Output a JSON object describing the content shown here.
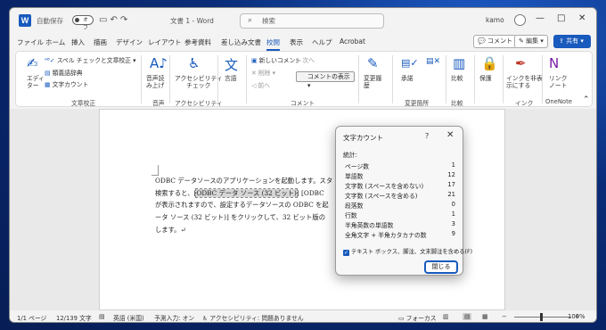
{
  "titlebar": {
    "autosave_label": "自動保存",
    "autosave_state": "オフ",
    "doc_title": "文書 1 - Word",
    "search_placeholder": "検索",
    "user_name": "kamo",
    "qat_icons": [
      "save-icon",
      "undo-icon",
      "redo-icon"
    ]
  },
  "menu": {
    "items": [
      "ファイル",
      "ホーム",
      "挿入",
      "描画",
      "デザイン",
      "レイアウト",
      "参考資料",
      "差し込み文書",
      "校閲",
      "表示",
      "ヘルプ",
      "Acrobat"
    ],
    "active": "校閲",
    "comment_btn": "コメント",
    "edit_btn": "編集",
    "share_btn": "共有"
  },
  "ribbon": {
    "editor": "エディ\nター",
    "spell": "スペル チェックと文章校正",
    "thesaurus": "類義語辞典",
    "word_count": "文字カウント",
    "read_aloud": "音声読\nみ上げ",
    "accessibility": "アクセシビリティ\nチェック",
    "language": "言語",
    "new_comment": "新しいコメント",
    "delete": "削除",
    "prev": "前へ",
    "next": "次へ",
    "show_comments": "コメントの表示",
    "track": "変更履\n歴",
    "accept": "承諾",
    "compare": "比較",
    "protect": "保護",
    "ink": "インクを非表\n示にする",
    "onenote": "リンク\nノート",
    "groups": {
      "proofing": "文章校正",
      "speech": "音声",
      "accessibility": "アクセシビリティ",
      "language": "言語",
      "comments": "コメント",
      "changes": "変更箇所",
      "compare": "比較",
      "ink": "インク",
      "onenote": "OneNote"
    }
  },
  "document": {
    "line1": "ODBC データソースのアプリケーションを起動します。スタ",
    "line2_pre": "検索すると、[",
    "line2_hl": "ODBC データ ソース (32 ビット)",
    "line2_post": "] [ODBC",
    "line3": "が表示されますので、設定するデータソースの ODBC を起",
    "line4": "ータ ソース (32 ビット)] をクリックして、32 ビット版の",
    "line5": "します。↵"
  },
  "dialog": {
    "title": "文字カウント",
    "help": "?",
    "stats_label": "統計:",
    "stats": [
      {
        "label": "ページ数",
        "value": "1"
      },
      {
        "label": "単語数",
        "value": "12"
      },
      {
        "label": "文字数 (スペースを含めない)",
        "value": "17"
      },
      {
        "label": "文字数 (スペースを含める)",
        "value": "21"
      },
      {
        "label": "段落数",
        "value": "0"
      },
      {
        "label": "行数",
        "value": "1"
      },
      {
        "label": "半角英数の単語数",
        "value": "3"
      },
      {
        "label": "全角文字 + 半角カタカナの数",
        "value": "9"
      }
    ],
    "checkbox_label": "テキスト ボックス、脚注、文末脚注を含める(F)",
    "close_button": "閉じる"
  },
  "statusbar": {
    "page": "1/1 ページ",
    "words": "12/139 文字",
    "language": "英語 (米国)",
    "input_mode": "予測入力: オン",
    "accessibility": "アクセシビリティ: 問題ありません",
    "focus": "フォーカス",
    "zoom": "100%"
  },
  "colors": {
    "accent": "#185abd"
  }
}
